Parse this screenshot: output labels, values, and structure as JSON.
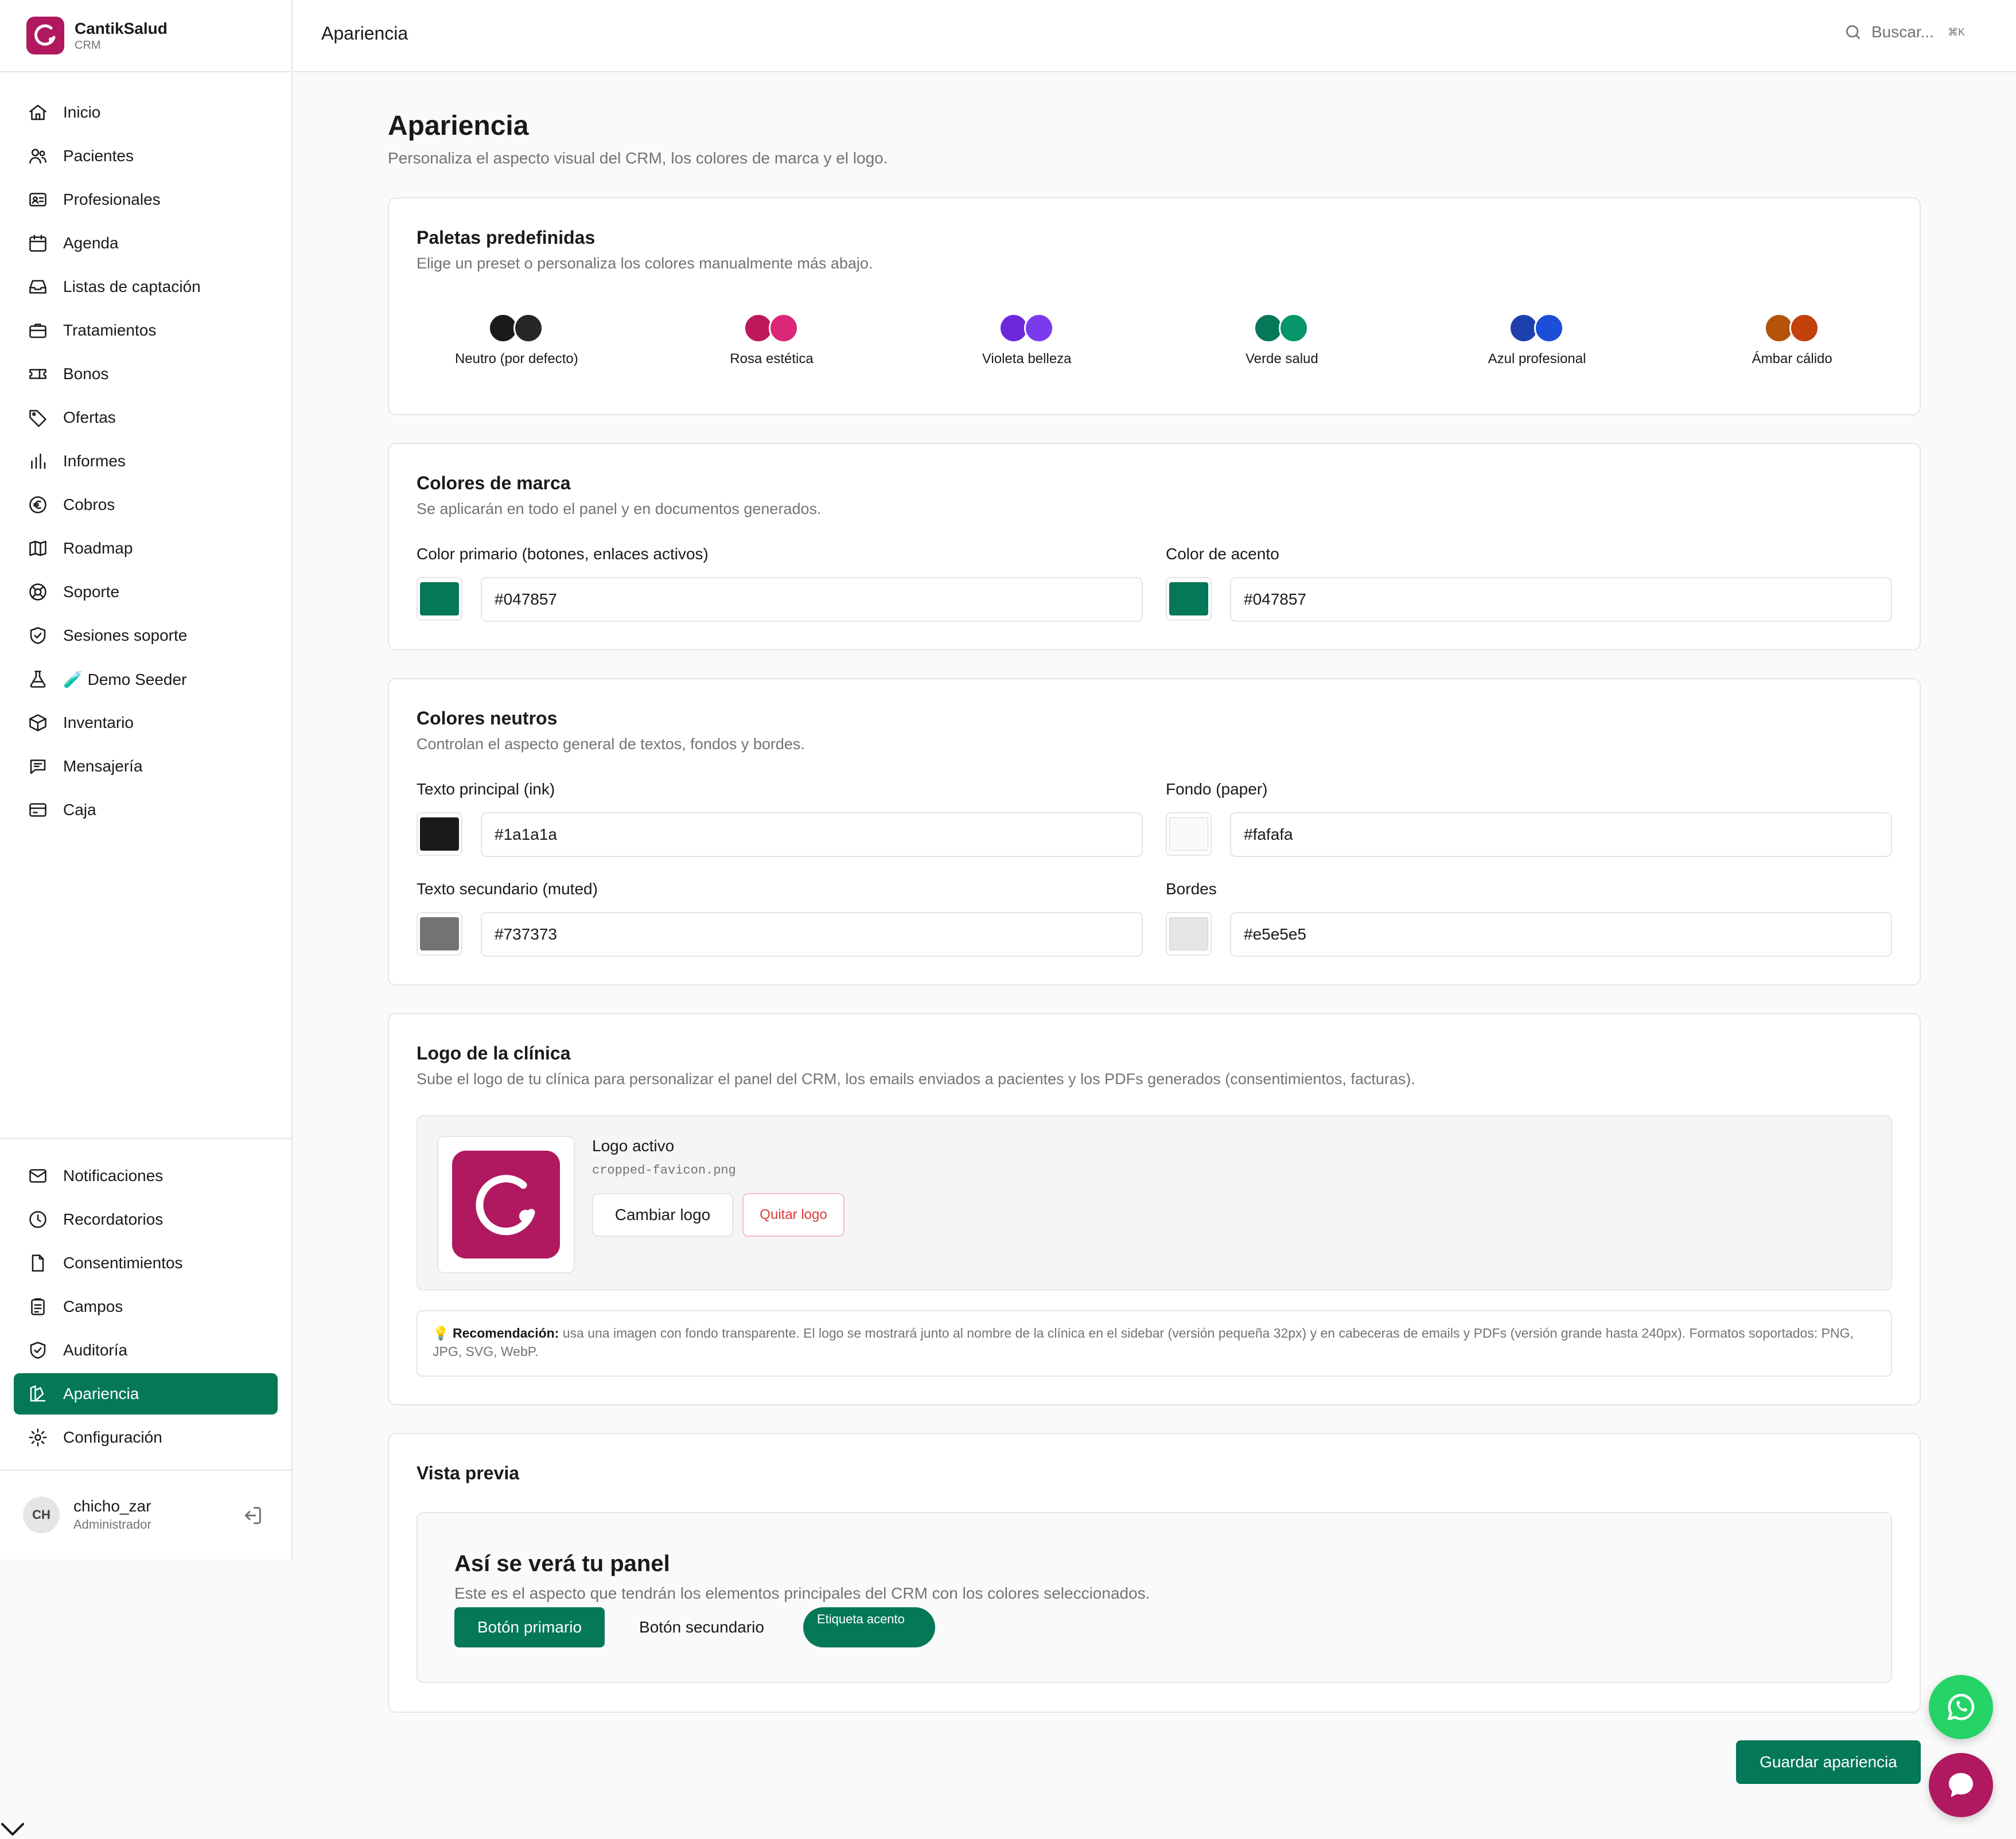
{
  "brand": {
    "name": "CantikSalud",
    "sub": "CRM"
  },
  "nav_main": [
    {
      "label": "Inicio",
      "icon": "home-icon"
    },
    {
      "label": "Pacientes",
      "icon": "users-icon"
    },
    {
      "label": "Profesionales",
      "icon": "id-card-icon"
    },
    {
      "label": "Agenda",
      "icon": "calendar-icon"
    },
    {
      "label": "Listas de captación",
      "icon": "inbox-icon"
    },
    {
      "label": "Tratamientos",
      "icon": "briefcase-icon"
    },
    {
      "label": "Bonos",
      "icon": "ticket-icon"
    },
    {
      "label": "Ofertas",
      "icon": "tag-icon"
    },
    {
      "label": "Informes",
      "icon": "bar-chart-icon"
    },
    {
      "label": "Cobros",
      "icon": "euro-icon"
    },
    {
      "label": "Roadmap",
      "icon": "map-icon"
    },
    {
      "label": "Soporte",
      "icon": "lifebuoy-icon"
    },
    {
      "label": "Sesiones soporte",
      "icon": "shield-check-icon"
    },
    {
      "label": "🧪 Demo Seeder",
      "icon": "flask-icon"
    },
    {
      "label": "Inventario",
      "icon": "box-icon"
    },
    {
      "label": "Mensajería",
      "icon": "chat-icon"
    },
    {
      "label": "Caja",
      "icon": "card-icon"
    }
  ],
  "nav_bottom": [
    {
      "label": "Notificaciones",
      "icon": "mail-icon"
    },
    {
      "label": "Recordatorios",
      "icon": "clock-icon"
    },
    {
      "label": "Consentimientos",
      "icon": "file-icon"
    },
    {
      "label": "Campos",
      "icon": "clipboard-icon"
    },
    {
      "label": "Auditoría",
      "icon": "shield-check-icon"
    },
    {
      "label": "Apariencia",
      "icon": "palette-icon",
      "active": true
    },
    {
      "label": "Configuración",
      "icon": "gear-icon"
    }
  ],
  "user": {
    "initials": "CH",
    "name": "chicho_zar",
    "role": "Administrador"
  },
  "header": {
    "title": "Apariencia",
    "search_placeholder": "Buscar...",
    "shortcut": "⌘K"
  },
  "page": {
    "title": "Apariencia",
    "subtitle": "Personaliza el aspecto visual del CRM, los colores de marca y el logo."
  },
  "presets": {
    "title": "Paletas predefinidas",
    "subtitle": "Elige un preset o personaliza los colores manualmente más abajo.",
    "items": [
      {
        "label": "Neutro (por defecto)",
        "c1": "#1a1a1a",
        "c2": "#262626"
      },
      {
        "label": "Rosa estética",
        "c1": "#be185d",
        "c2": "#db2777"
      },
      {
        "label": "Violeta belleza",
        "c1": "#6d28d9",
        "c2": "#7c3aed"
      },
      {
        "label": "Verde salud",
        "c1": "#047857",
        "c2": "#059669"
      },
      {
        "label": "Azul profesional",
        "c1": "#1e40af",
        "c2": "#1d4ed8"
      },
      {
        "label": "Ámbar cálido",
        "c1": "#b45309",
        "c2": "#c2410c"
      }
    ]
  },
  "brand_colors": {
    "title": "Colores de marca",
    "subtitle": "Se aplicarán en todo el panel y en documentos generados.",
    "primary_label": "Color primario (botones, enlaces activos)",
    "primary_value": "#047857",
    "accent_label": "Color de acento",
    "accent_value": "#047857"
  },
  "neutral_colors": {
    "title": "Colores neutros",
    "subtitle": "Controlan el aspecto general de textos, fondos y bordes.",
    "ink_label": "Texto principal (ink)",
    "ink_value": "#1a1a1a",
    "paper_label": "Fondo (paper)",
    "paper_value": "#fafafa",
    "muted_label": "Texto secundario (muted)",
    "muted_value": "#737373",
    "border_label": "Bordes",
    "border_value": "#e5e5e5"
  },
  "logo": {
    "title": "Logo de la clínica",
    "subtitle": "Sube el logo de tu clínica para personalizar el panel del CRM, los emails enviados a pacientes y los PDFs generados (consentimientos, facturas).",
    "active_label": "Logo activo",
    "filename": "cropped-favicon.png",
    "change_label": "Cambiar logo",
    "remove_label": "Quitar logo",
    "rec_icon": "💡",
    "rec_bold": "Recomendación:",
    "rec_text": " usa una imagen con fondo transparente. El logo se mostrará junto al nombre de la clínica en el sidebar (versión pequeña 32px) y en cabeceras de emails y PDFs (versión grande hasta 240px). Formatos soportados: PNG, JPG, SVG, WebP."
  },
  "preview": {
    "title": "Vista previa",
    "panel_title": "Así se verá tu panel",
    "panel_sub": "Este es el aspecto que tendrán los elementos principales del CRM con los colores seleccionados.",
    "primary_btn": "Botón primario",
    "secondary_btn": "Botón secundario",
    "accent_tag": "Etiqueta acento"
  },
  "save_label": "Guardar apariencia",
  "colors": {
    "primary": "#047857",
    "brand_logo": "#b0195f",
    "whatsapp": "#25d366"
  }
}
